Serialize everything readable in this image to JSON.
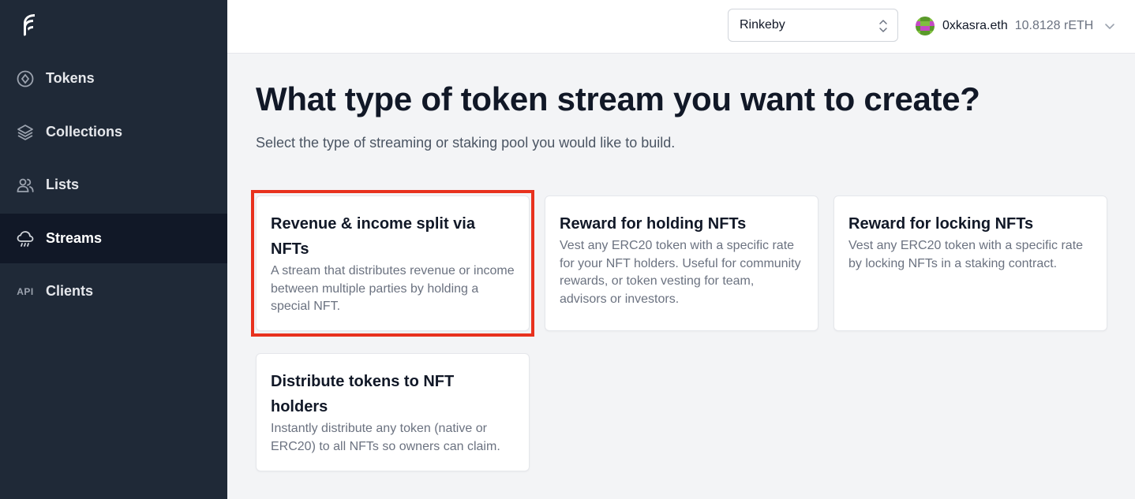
{
  "sidebar": {
    "logo_icon": "flame-logo-icon",
    "items": [
      {
        "label": "Tokens",
        "icon": "token-icon",
        "active": false
      },
      {
        "label": "Collections",
        "icon": "layers-icon",
        "active": false
      },
      {
        "label": "Lists",
        "icon": "users-icon",
        "active": false
      },
      {
        "label": "Streams",
        "icon": "cloud-rain-icon",
        "active": true
      },
      {
        "label": "Clients",
        "icon": "api-icon",
        "icon_text": "API",
        "active": false
      }
    ]
  },
  "topbar": {
    "network": {
      "selected": "Rinkeby"
    },
    "account": {
      "name": "0xkasra.eth",
      "balance": "10.8128 rETH"
    }
  },
  "main": {
    "title": "What type of token stream you want to create?",
    "subtitle": "Select the type of streaming or staking pool you would like to build.",
    "cards": [
      {
        "title": "Revenue & income split via NFTs",
        "description": "A stream that distributes revenue or income between multiple parties by holding a special NFT.",
        "highlighted": true
      },
      {
        "title": "Reward for holding NFTs",
        "description": "Vest any ERC20 token with a specific rate for your NFT holders. Useful for community rewards, or token vesting for team, advisors or investors.",
        "highlighted": false
      },
      {
        "title": "Reward for locking NFTs",
        "description": "Vest any ERC20 token with a specific rate by locking NFTs in a staking contract.",
        "highlighted": false
      },
      {
        "title": "Distribute tokens to NFT holders",
        "description": "Instantly distribute any token (native or ERC20) to all NFTs so owners can claim.",
        "highlighted": false
      }
    ]
  },
  "colors": {
    "sidebar_bg": "#1f2937",
    "sidebar_active_bg": "#111827",
    "page_bg": "#f3f4f6",
    "highlight": "#e8321e"
  }
}
